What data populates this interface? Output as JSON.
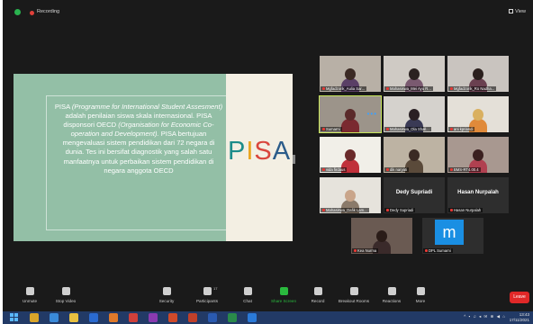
{
  "window": {
    "recording_label": "Recording",
    "view_label": "View"
  },
  "slide": {
    "text_parts": [
      {
        "t": "PISA ",
        "i": false
      },
      {
        "t": "(Programme for International Student Assesment)",
        "i": true
      },
      {
        "t": " adalah penilaian siswa skala internasional. PISA disponsori OECD ",
        "i": false
      },
      {
        "t": "(Organisation for Economic Co-operation and Development).",
        "i": true
      },
      {
        "t": " PISA bertujuan mengevaluasi sistem pendidikan dari 72 negara di dunia. Tes ini bersifat diagnostik yang salah satu manfaatnya untuk perbaikan sistem pendidikan di negara anggota OECD",
        "i": false
      }
    ],
    "logo_letters": [
      "P",
      "I",
      "S",
      "A"
    ]
  },
  "participants": [
    {
      "name": "Mgfadzorik_Aulia Sar...",
      "kind": "video",
      "bg": "#b8b0a6",
      "skin": "#3b2a24",
      "cloth": "#5a3f66",
      "active": false
    },
    {
      "name": "Mahasiswa_Mei Ayu R...",
      "kind": "video",
      "bg": "#cfcac4",
      "skin": "#2b2220",
      "cloth": "#7a5a70",
      "active": false
    },
    {
      "name": "Mgfadzorik_Ro Nadha...",
      "kind": "video",
      "bg": "#c9c4bf",
      "skin": "#2a1f1d",
      "cloth": "#6a4050",
      "active": false
    },
    {
      "name": "Sumarni",
      "kind": "video",
      "bg": "#9c948a",
      "skin": "#5a2a2a",
      "cloth": "#7a2a30",
      "active": true
    },
    {
      "name": "Mahasiswa_Ola Shall...",
      "kind": "video",
      "bg": "#d5d2cd",
      "skin": "#2a2024",
      "cloth": "#3a3a55",
      "active": false
    },
    {
      "name": "ani kpriandi",
      "kind": "video",
      "bg": "#e4e0d8",
      "skin": "#d9b060",
      "cloth": "#e08a3a",
      "active": false
    },
    {
      "name": "vida firdaus",
      "kind": "video",
      "bg": "#f1efe8",
      "skin": "#6a2a2a",
      "cloth": "#c0303a",
      "active": false
    },
    {
      "name": "dik naryati",
      "kind": "video",
      "bg": "#bdb3a3",
      "skin": "#3a2a24",
      "cloth": "#5a4a3a",
      "active": false
    },
    {
      "name": "BMS-RT4.00.4",
      "kind": "video",
      "bg": "#a89890",
      "skin": "#3a2020",
      "cloth": "#b04050",
      "active": false
    },
    {
      "name": "Mahasiswa_Dafik Lam...",
      "kind": "video",
      "bg": "#e6e3dc",
      "skin": "#c9a58a",
      "cloth": "#8a7a6a",
      "active": false
    },
    {
      "name": "Dedy Supriadi",
      "kind": "name",
      "active": false
    },
    {
      "name": "Hasan Nurpalah",
      "kind": "name",
      "active": false
    },
    {
      "name": "Kea Nurma",
      "kind": "video",
      "bg": "#6a5a52",
      "skin": "#2a1c18",
      "cloth": "#3a2a2a",
      "active": false
    },
    {
      "name": "DPL Sumarni",
      "kind": "logo",
      "logo_letter": "m",
      "active": false
    }
  ],
  "toolbar": {
    "items": [
      {
        "label": "Unmute",
        "icon": "microphone-muted-icon",
        "green": false
      },
      {
        "label": "Stop Video",
        "icon": "video-camera-icon",
        "green": false
      },
      {
        "label": "Security",
        "icon": "shield-icon",
        "green": false
      },
      {
        "label": "Participants",
        "icon": "people-icon",
        "green": false,
        "count": "17"
      },
      {
        "label": "Chat",
        "icon": "chat-bubble-icon",
        "green": false
      },
      {
        "label": "Share Screen",
        "icon": "share-screen-icon",
        "green": true
      },
      {
        "label": "Record",
        "icon": "record-icon",
        "green": false
      },
      {
        "label": "Breakout Rooms",
        "icon": "breakout-rooms-icon",
        "green": false
      },
      {
        "label": "Reactions",
        "icon": "reactions-icon",
        "green": false
      },
      {
        "label": "More",
        "icon": "more-dots-icon",
        "green": false
      }
    ],
    "leave_label": "Leave"
  },
  "taskbar": {
    "apps": [
      {
        "icon": "chrome-icon",
        "color": "#d9a52a"
      },
      {
        "icon": "edge-icon",
        "color": "#3a8ad9"
      },
      {
        "icon": "file-explorer-icon",
        "color": "#e8c040"
      },
      {
        "icon": "outlook-icon",
        "color": "#2a6ad0"
      },
      {
        "icon": "firefox-icon",
        "color": "#e07a2a"
      },
      {
        "icon": "browser-icon",
        "color": "#d0403a"
      },
      {
        "icon": "onenote-icon",
        "color": "#8a3ab0"
      },
      {
        "icon": "powerpoint-icon",
        "color": "#d04a2a"
      },
      {
        "icon": "powerpoint-icon",
        "color": "#c0402a"
      },
      {
        "icon": "word-icon",
        "color": "#2a5ab0"
      },
      {
        "icon": "excel-icon",
        "color": "#2a8a4a"
      },
      {
        "icon": "zoom-icon",
        "color": "#2a7ad9"
      }
    ],
    "tray_text": "^ ▪ ♫ ◂ ✉ ⊕ ◀ ⌂",
    "time": "13:43",
    "date": "17/11/2021"
  }
}
